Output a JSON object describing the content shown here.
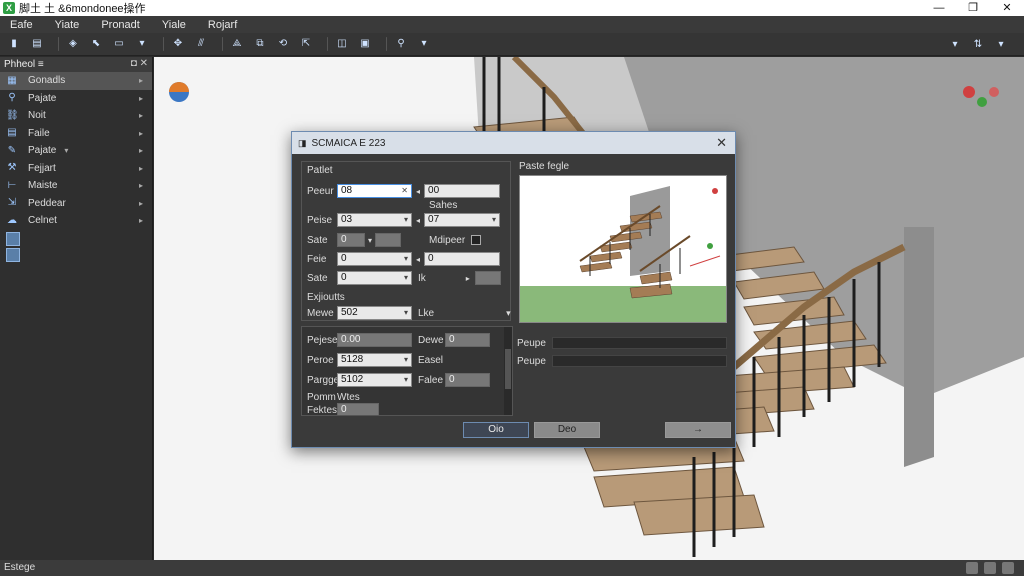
{
  "app": {
    "title": "脚土 土 &6mondonee操作"
  },
  "window_controls": {
    "minimize": "—",
    "maximize": "❐",
    "close": "✕"
  },
  "menu": {
    "items": [
      "Eafe",
      "Yiate",
      "Pronadt",
      "Yiale",
      "Rojarf"
    ]
  },
  "sidebar": {
    "header": "Phheol ≡",
    "header_controls": "◘ ✕",
    "items": [
      {
        "label": "Gonadls",
        "selected": true
      },
      {
        "label": "Pajate"
      },
      {
        "label": "Noit"
      },
      {
        "label": "Faile"
      },
      {
        "label": "Pajate",
        "dropdown": "▾"
      },
      {
        "label": "Fejjart"
      },
      {
        "label": "Maiste"
      },
      {
        "label": "Peddear"
      },
      {
        "label": "Celnet"
      }
    ]
  },
  "status": {
    "text": "Estege"
  },
  "dialog": {
    "title": "SCMAICA E 223",
    "close": "✕",
    "section_top": "Patlet",
    "row1": {
      "label": "Peeur",
      "value": "08",
      "right_value": "00"
    },
    "row1_note": "Sahes",
    "row2": {
      "label": "Peise",
      "value": "03",
      "right_value": "07"
    },
    "row3": {
      "label": "Sate",
      "value": "0",
      "right_label": "Mdipeer"
    },
    "row4": {
      "label": "Feie",
      "value": "0",
      "right_value": "0"
    },
    "row5": {
      "label": "Sate",
      "value": "0",
      "right_label": "Ik"
    },
    "section_mid": "Exjioutts",
    "row6": {
      "label": "Mewe",
      "value": "502",
      "right_label": "Lke"
    },
    "lower": {
      "r1": {
        "label": "Pejese",
        "value": "0.00",
        "right_label": "Dewe",
        "right_value": "0"
      },
      "r2": {
        "label": "Peroe",
        "value": "5128",
        "right_label": "Easel"
      },
      "r3": {
        "label": "Pargge",
        "value": "5102",
        "right_label": "Falee",
        "right_value": "0"
      },
      "r4": {
        "label": "Pomm",
        "right_label": "Wtes"
      },
      "r5": {
        "label": "Fektes",
        "value": "0"
      }
    },
    "preview_label": "Paste fegle",
    "right_rows": [
      "Peupe",
      "Peupe"
    ],
    "buttons": {
      "ok": "Oio",
      "cancel": "Deo",
      "next": "→"
    }
  },
  "colors": {
    "accent": "#6d8bb0",
    "sidebar": "#2f2f2f",
    "viewport": "#f4f4f4"
  }
}
